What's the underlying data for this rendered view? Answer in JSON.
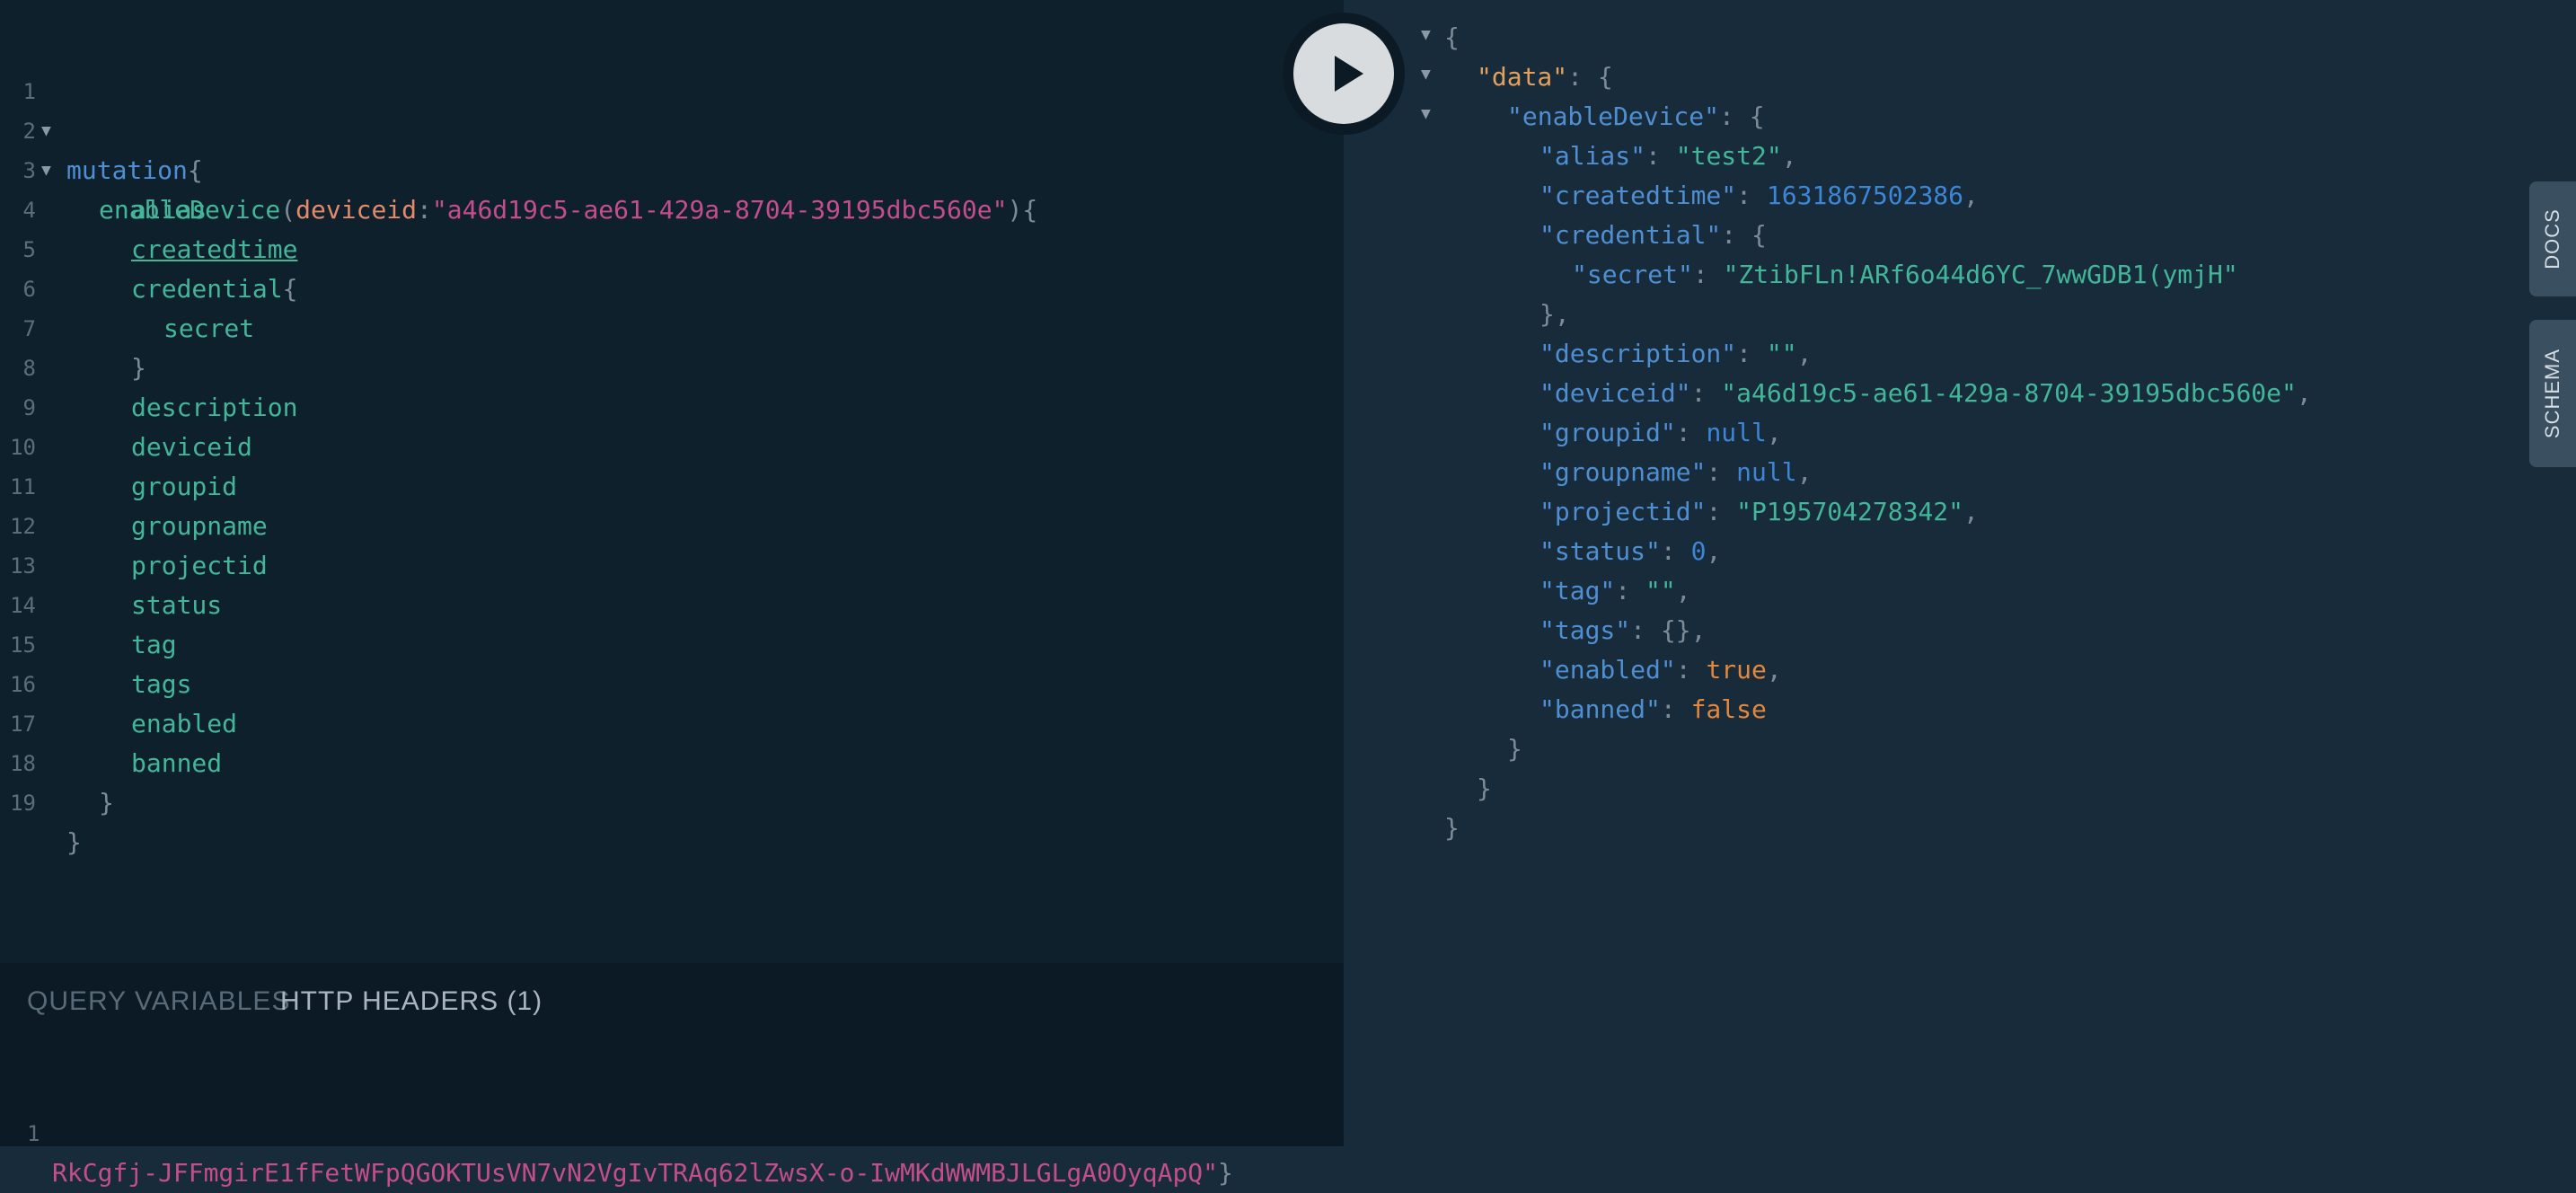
{
  "editor": {
    "lines": [
      {
        "n": "1"
      },
      {
        "n": "2"
      },
      {
        "n": "3"
      },
      {
        "n": "4"
      },
      {
        "n": "5"
      },
      {
        "n": "6"
      },
      {
        "n": "7"
      },
      {
        "n": "8"
      },
      {
        "n": "9"
      },
      {
        "n": "10"
      },
      {
        "n": "11"
      },
      {
        "n": "12"
      },
      {
        "n": "13"
      },
      {
        "n": "14"
      },
      {
        "n": "15"
      },
      {
        "n": "16"
      },
      {
        "n": "17"
      },
      {
        "n": "18"
      },
      {
        "n": "19"
      }
    ],
    "mutation_kw": "mutation",
    "open_brace": "{",
    "close_brace": "}",
    "fn_name": "enableDevice",
    "paren_open": "(",
    "arg_name": "deviceid",
    "colon": ":",
    "arg_value": "\"a46d19c5-ae61-429a-8704-39195dbc560e\"",
    "paren_close": ")",
    "fields": {
      "alias": "alias",
      "createdtime": "createdtime",
      "credential": "credential",
      "secret": "secret",
      "description": "description",
      "deviceid": "deviceid",
      "groupid": "groupid",
      "groupname": "groupname",
      "projectid": "projectid",
      "status": "status",
      "tag": "tag",
      "tags": "tags",
      "enabled": "enabled",
      "banned": "banned"
    }
  },
  "variables_panel": {
    "tab_query_variables": "QUERY VARIABLES",
    "tab_http_headers": "HTTP HEADERS (1)",
    "line_number": "1",
    "header_value": "RkCgfj-JFFmgirE1fFetWFpQGOKTUsVN7vN2VgIvTRAq62lZwsX-o-IwMKdWWMBJLGLgA0OyqApQ\"",
    "close_brace": "}"
  },
  "result": {
    "open": "{",
    "data_key": "\"data\"",
    "enable_key": "\"enableDevice\"",
    "alias_key": "\"alias\"",
    "alias_val": "\"test2\"",
    "createdtime_key": "\"createdtime\"",
    "createdtime_val": "1631867502386",
    "credential_key": "\"credential\"",
    "secret_key": "\"secret\"",
    "secret_val": "\"ZtibFLn!ARf6o44d6YC_7wwGDB1(ymjH\"",
    "description_key": "\"description\"",
    "description_val": "\"\"",
    "deviceid_key": "\"deviceid\"",
    "deviceid_val": "\"a46d19c5-ae61-429a-8704-39195dbc560e\"",
    "groupid_key": "\"groupid\"",
    "groupid_val": "null",
    "groupname_key": "\"groupname\"",
    "groupname_val": "null",
    "projectid_key": "\"projectid\"",
    "projectid_val": "\"P195704278342\"",
    "status_key": "\"status\"",
    "status_val": "0",
    "tag_key": "\"tag\"",
    "tag_val": "\"\"",
    "tags_key": "\"tags\"",
    "tags_val": "{}",
    "enabled_key": "\"enabled\"",
    "enabled_val": "true",
    "banned_key": "\"banned\"",
    "banned_val": "false",
    "close": "}",
    "close_comma": "},",
    "sep": ": ",
    "open_tail": ": {",
    "comma": ","
  },
  "side_tabs": {
    "docs": "DOCS",
    "schema": "SCHEMA"
  },
  "icons": {
    "play": "play-icon",
    "fold": "fold-arrow-icon"
  }
}
